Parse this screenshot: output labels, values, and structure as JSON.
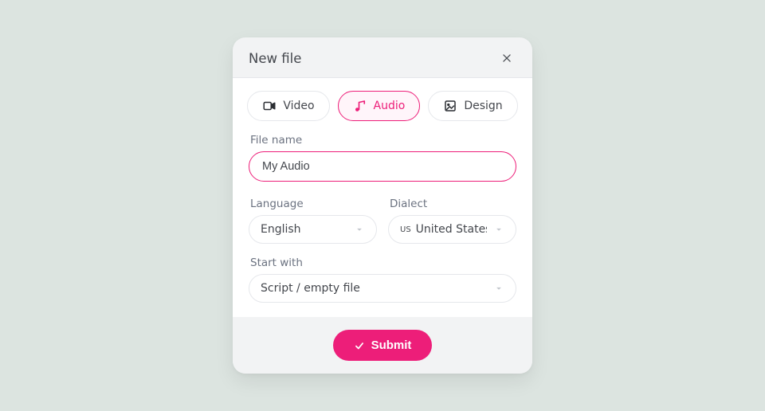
{
  "modal": {
    "title": "New file"
  },
  "types": {
    "video": "Video",
    "audio": "Audio",
    "design": "Design",
    "active": "audio"
  },
  "filename": {
    "label": "File name",
    "value": "My Audio"
  },
  "language": {
    "label": "Language",
    "value": "English"
  },
  "dialect": {
    "label": "Dialect",
    "flag": "US",
    "value": "United States"
  },
  "startwith": {
    "label": "Start with",
    "value": "Script / empty file"
  },
  "submit": {
    "label": "Submit"
  }
}
